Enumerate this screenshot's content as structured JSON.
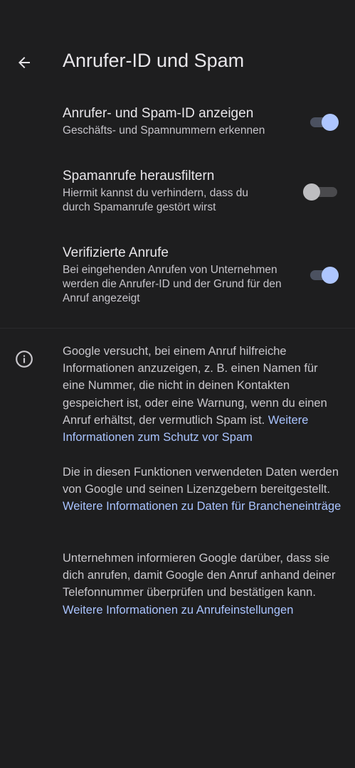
{
  "header": {
    "title": "Anrufer-ID und Spam"
  },
  "settings": [
    {
      "title": "Anrufer- und Spam-ID anzeigen",
      "description": "Geschäfts- und Spamnummern erkennen",
      "enabled": true
    },
    {
      "title": "Spamanrufe herausfiltern",
      "description": "Hiermit kannst du verhindern, dass du durch Spamanrufe gestört wirst",
      "enabled": false
    },
    {
      "title": "Verifizierte Anrufe",
      "description": "Bei eingehenden Anrufen von Unternehmen werden die Anrufer-ID und der Grund für den Anruf angezeigt",
      "enabled": true
    }
  ],
  "info": {
    "paragraphs": [
      {
        "text": "Google versucht, bei einem Anruf hilfreiche Informationen anzuzeigen, z. B. einen Namen für eine Nummer, die nicht in deinen Kontakten gespeichert ist, oder eine Warnung, wenn du einen Anruf erhältst, der vermutlich Spam ist.",
        "link": "Weitere Informationen zum Schutz vor Spam"
      },
      {
        "text": "Die in diesen Funktionen verwendeten Daten werden von Google und seinen Lizenzgebern bereitgestellt.",
        "link": "Weitere Informationen zu Daten für Brancheneinträge"
      },
      {
        "text": "Unternehmen informieren Google darüber, dass sie dich anrufen, damit Google den Anruf anhand deiner Telefonnummer überprüfen und bestätigen kann.",
        "link": "Weitere Informationen zu Anrufeinstellungen"
      }
    ]
  },
  "icons": {
    "back": "arrow-back-icon",
    "info": "info-icon"
  },
  "colors": {
    "background": "#1e1e1f",
    "accent": "#aec6ff",
    "link": "#a9c3ff"
  }
}
